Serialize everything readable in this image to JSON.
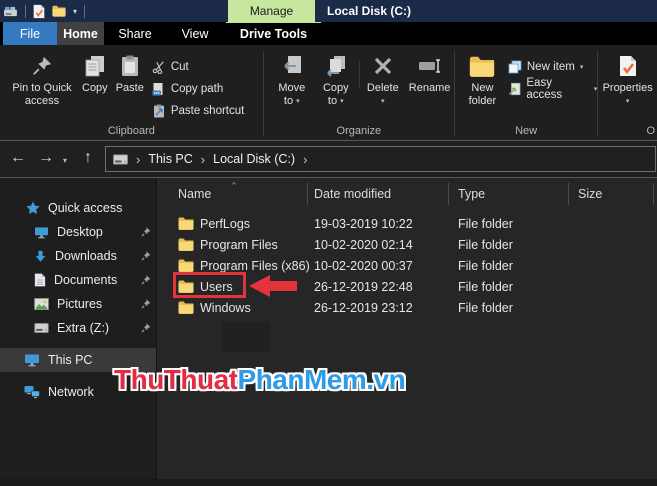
{
  "ui": {
    "caret": "▾",
    "qat_chevron": "▾",
    "back_arrow": "←",
    "forward_arrow": "→",
    "nav_chevron": "▾",
    "up_arrow": "↑",
    "breadcrumb_sep": "›",
    "sort_indicator": "^"
  },
  "titlebar": {
    "manage_tab": "Manage",
    "title": "Local Disk (C:)"
  },
  "tabs": [
    {
      "label": "File"
    },
    {
      "label": "Home"
    },
    {
      "label": "Share"
    },
    {
      "label": "View"
    },
    {
      "label": "Drive Tools"
    }
  ],
  "ribbon": {
    "clipboard_group": {
      "label": "Clipboard",
      "pin_button": "Pin to Quick access",
      "copy_button": "Copy",
      "paste_button": "Paste",
      "cut_button": "Cut",
      "copy_path_button": "Copy path",
      "paste_shortcut_button": "Paste shortcut"
    },
    "organize_group": {
      "label": "Organize",
      "move_to_button": "Move to",
      "copy_to_button": "Copy to",
      "delete_button": "Delete",
      "rename_button": "Rename"
    },
    "new_group": {
      "label": "New",
      "new_folder_button": "New folder",
      "new_item_button": "New item",
      "easy_access_button": "Easy access"
    },
    "open_group": {
      "label": "O",
      "properties_button": "Properties"
    }
  },
  "navbar": {
    "breadcrumb": [
      {
        "label": "This PC"
      },
      {
        "label": "Local Disk (C:)"
      }
    ]
  },
  "sidebar": {
    "items": [
      {
        "label": "Quick access"
      },
      {
        "label": "Desktop"
      },
      {
        "label": "Downloads"
      },
      {
        "label": "Documents"
      },
      {
        "label": "Pictures"
      },
      {
        "label": "Extra (Z:)"
      },
      {
        "label": "This PC"
      },
      {
        "label": "Network"
      }
    ]
  },
  "filelist": {
    "columns": [
      {
        "label": "Name"
      },
      {
        "label": "Date modified"
      },
      {
        "label": "Type"
      },
      {
        "label": "Size"
      }
    ],
    "rows": [
      {
        "name": "PerfLogs",
        "date_modified": "19-03-2019 10:22",
        "type": "File folder",
        "size": ""
      },
      {
        "name": "Program Files",
        "date_modified": "10-02-2020 02:14",
        "type": "File folder",
        "size": ""
      },
      {
        "name": "Program Files (x86)",
        "date_modified": "10-02-2020 00:37",
        "type": "File folder",
        "size": ""
      },
      {
        "name": "Users",
        "date_modified": "26-12-2019 22:48",
        "type": "File folder",
        "size": ""
      },
      {
        "name": "Windows",
        "date_modified": "26-12-2019 23:12",
        "type": "File folder",
        "size": ""
      }
    ]
  },
  "watermark": {
    "part1": "ThuThuat",
    "part2": "PhanMem.vn"
  },
  "colors": {
    "annotation_red": "#e5333e",
    "watermark_red": "#e32b44",
    "watermark_blue": "#2d9be5",
    "accent_blue": "#3579c0",
    "manage_green": "#c8e79e",
    "titlebar_navy": "#1b2b47"
  }
}
